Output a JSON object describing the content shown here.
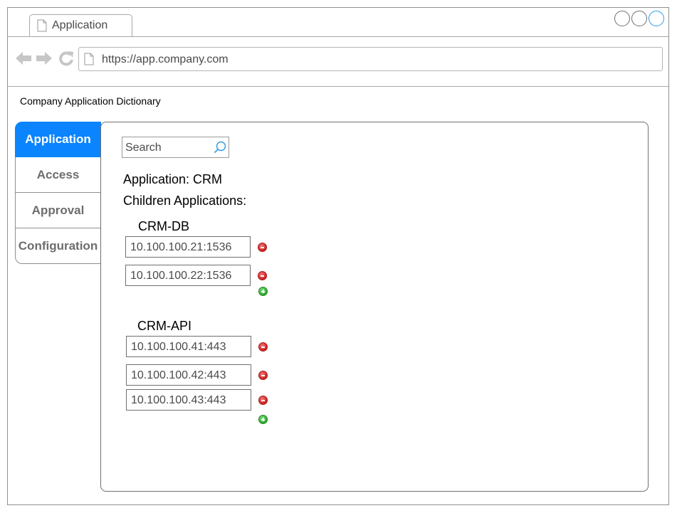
{
  "browser": {
    "tab_title": "Application",
    "url": "https://app.company.com"
  },
  "page_heading": "Company Application Dictionary",
  "sidebar": {
    "tabs": [
      {
        "label": "Application",
        "active": true
      },
      {
        "label": "Access",
        "active": false
      },
      {
        "label": "Approval",
        "active": false
      },
      {
        "label": "Configuration",
        "active": false
      }
    ]
  },
  "main": {
    "search_placeholder": "Search",
    "application_line": "Application: CRM",
    "children_label": "Children Applications:",
    "groups": [
      {
        "name": "CRM-DB",
        "endpoints": [
          "10.100.100.21:1536",
          "10.100.100.22:1536"
        ]
      },
      {
        "name": "CRM-API",
        "endpoints": [
          "10.100.100.41:443",
          "10.100.100.42:443",
          "10.100.100.43:443"
        ]
      }
    ]
  },
  "colors": {
    "accent": "#0a84ff",
    "remove": "#cc1f1f",
    "add": "#2ea82e"
  }
}
